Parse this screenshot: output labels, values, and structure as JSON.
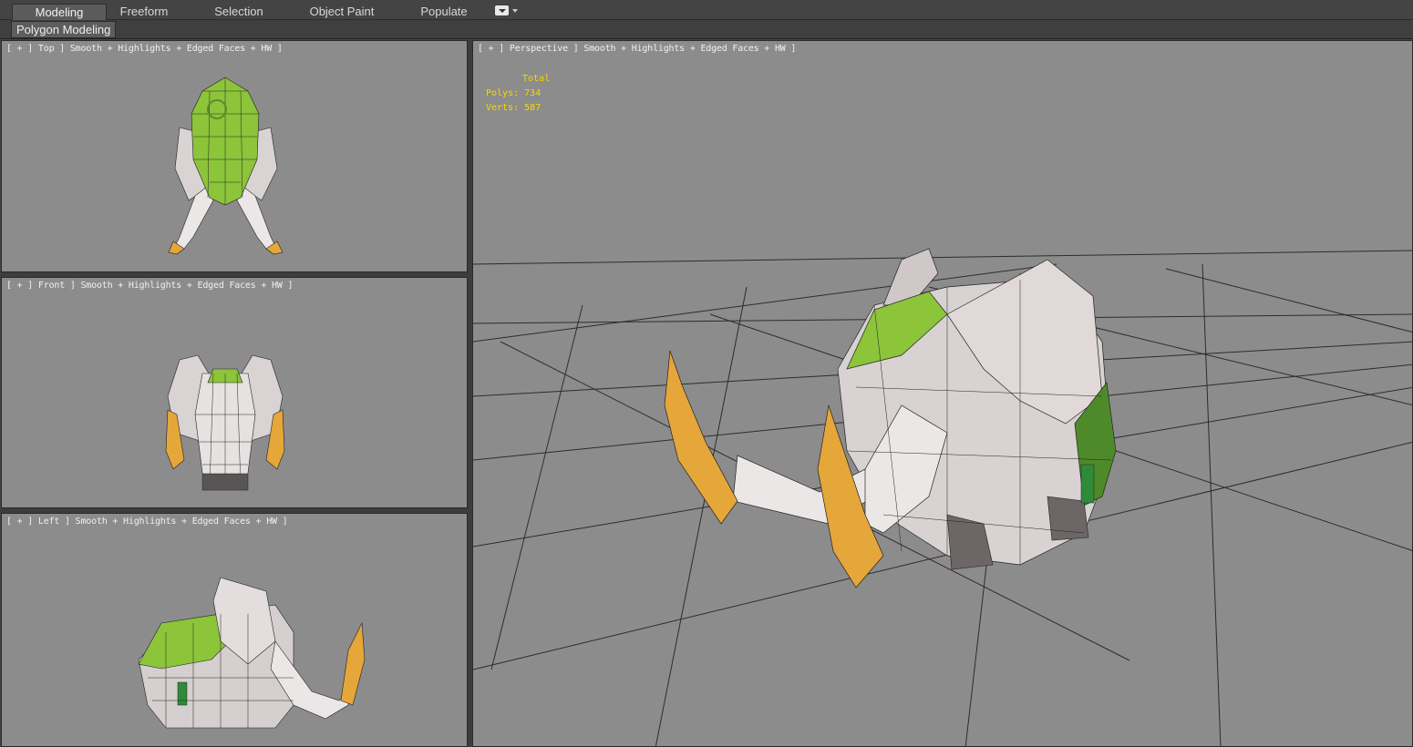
{
  "ribbon": {
    "tabs": [
      {
        "label": "Modeling",
        "active": true
      },
      {
        "label": "Freeform",
        "active": false
      },
      {
        "label": "Selection",
        "active": false
      },
      {
        "label": "Object Paint",
        "active": false
      },
      {
        "label": "Populate",
        "active": false
      }
    ],
    "panel_label": "Polygon Modeling"
  },
  "viewports": {
    "top": {
      "label": "[ + ] Top ] Smooth + Highlights + Edged Faces + HW ]"
    },
    "front": {
      "label": "[ + ] Front ] Smooth + Highlights + Edged Faces + HW ]"
    },
    "left": {
      "label": "[ + ] Left ] Smooth + Highlights + Edged Faces + HW ]"
    },
    "perspective": {
      "label": "[ + ] Perspective ] Smooth + Highlights + Edged Faces + HW ]"
    }
  },
  "stats": {
    "header": "Total",
    "polys_label": "Polys:",
    "polys_value": "734",
    "verts_label": "Verts:",
    "verts_value": "587"
  },
  "colors": {
    "viewport_bg": "#8c8c8c",
    "stats_text": "#f5d800",
    "saddle_green": "#8cc43a",
    "tusk_gold": "#e5a63a",
    "body_white": "#e6e2e2"
  }
}
